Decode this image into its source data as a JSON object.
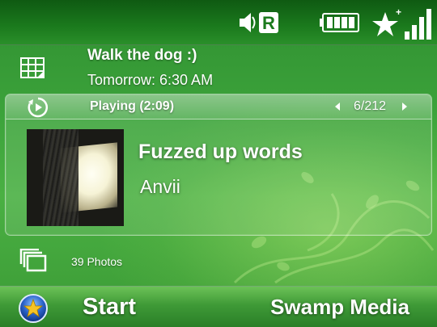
{
  "status_bar": {
    "sound_icon": "speaker-icon",
    "roaming_badge": "R",
    "battery_icon": "battery-icon",
    "notification_icon": "star-plus-icon",
    "signal_icon": "signal-bars-icon"
  },
  "calendar": {
    "icon": "calendar-icon",
    "title": "Walk the dog :)",
    "time": "Tomorrow: 6:30 AM"
  },
  "media": {
    "icon": "play-icon",
    "status": "Playing (2:09)",
    "track_counter": "6/212",
    "prev_icon": "triangle-left-icon",
    "next_icon": "triangle-right-icon",
    "song_title": "Fuzzed up words",
    "artist": "Anvii"
  },
  "photos": {
    "icon": "photos-stack-icon",
    "label": "39 Photos"
  },
  "softkeys": {
    "start_icon": "start-orb-icon",
    "left": "Start",
    "right": "Swamp Media"
  },
  "colors": {
    "background": "#3ca33b",
    "status_bar": "#1b7a1d",
    "softkey_bar": "#3f9a37"
  }
}
